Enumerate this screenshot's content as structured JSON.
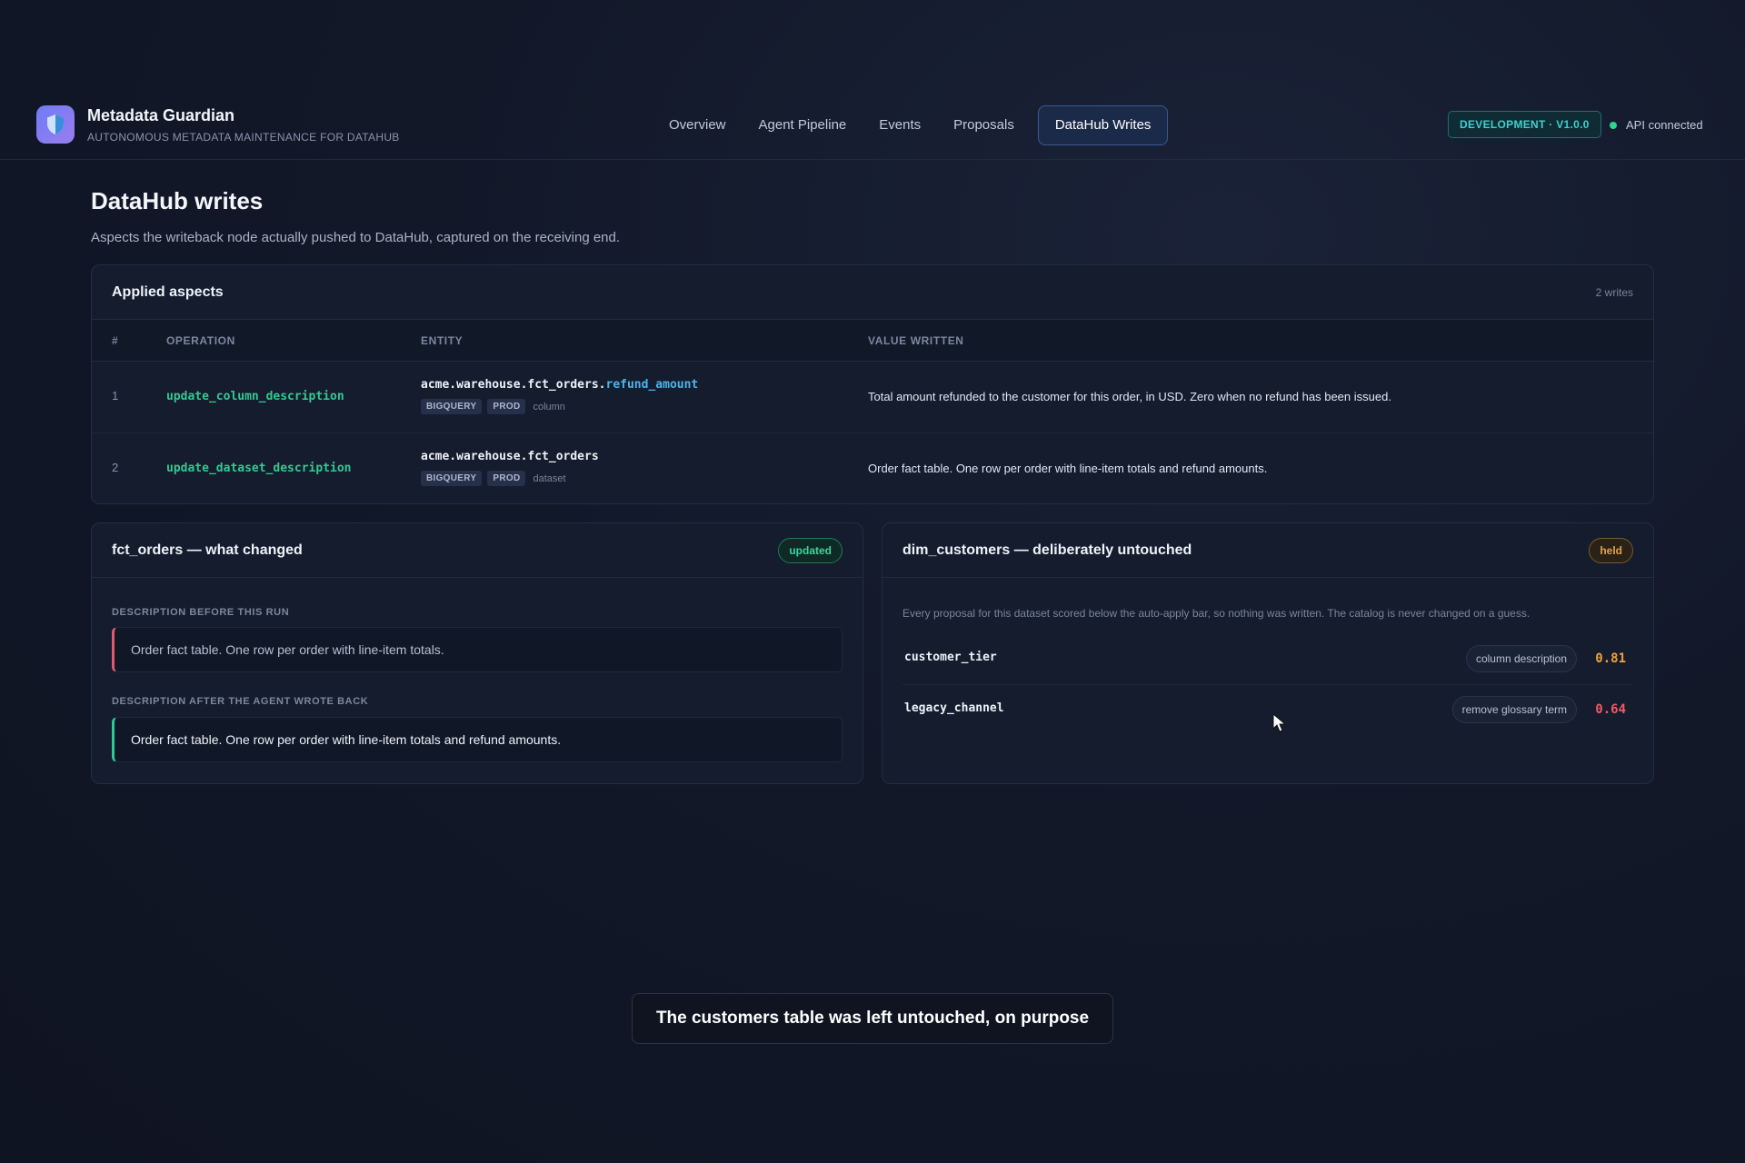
{
  "app": {
    "title": "Metadata Guardian",
    "subtitle": "AUTONOMOUS METADATA MAINTENANCE FOR DATAHUB",
    "logo_icon": "shield-icon"
  },
  "nav": {
    "items": [
      {
        "label": "Overview"
      },
      {
        "label": "Agent Pipeline"
      },
      {
        "label": "Events"
      },
      {
        "label": "Proposals"
      },
      {
        "label": "DataHub Writes",
        "active": true
      }
    ]
  },
  "status": {
    "env": "DEVELOPMENT · V1.0.0",
    "api": "API connected",
    "api_color": "#2fd48f"
  },
  "page": {
    "title": "DataHub writes",
    "subtitle": "Aspects the writeback node actually pushed to DataHub, captured on the receiving end."
  },
  "aspects": {
    "title": "Applied aspects",
    "count": "2 writes",
    "columns": {
      "num": "#",
      "operation": "OPERATION",
      "entity": "ENTITY",
      "value": "VALUE WRITTEN"
    },
    "rows": [
      {
        "num": "1",
        "operation": "update_column_description",
        "entity_base": "acme.warehouse.fct_orders.",
        "entity_column": "refund_amount",
        "platform": "BIGQUERY",
        "env": "PROD",
        "kind": "column",
        "value": "Total amount refunded to the customer for this order, in USD. Zero when no refund has been issued."
      },
      {
        "num": "2",
        "operation": "update_dataset_description",
        "entity_base": "acme.warehouse.fct_orders",
        "entity_column": "",
        "platform": "BIGQUERY",
        "env": "PROD",
        "kind": "dataset",
        "value": "Order fact table. One row per order with line-item totals and refund amounts."
      }
    ]
  },
  "changed": {
    "title": "fct_orders — what changed",
    "badge": "updated",
    "before_label": "DESCRIPTION BEFORE THIS RUN",
    "before_value": "Order fact table. One row per order with line-item totals.",
    "after_label": "DESCRIPTION AFTER THE AGENT WROTE BACK",
    "after_value": "Order fact table. One row per order with line-item totals and refund amounts."
  },
  "untouched": {
    "title": "dim_customers — deliberately untouched",
    "badge": "held",
    "note": "Every proposal for this dataset scored below the auto-apply bar, so nothing was written. The catalog is never changed on a guess.",
    "items": [
      {
        "field": "customer_tier",
        "kind": "column description",
        "score": "0.81",
        "score_color": "#f0a23c"
      },
      {
        "field": "legacy_channel",
        "kind": "remove glossary term",
        "score": "0.64",
        "score_color": "#f05a64"
      }
    ]
  },
  "caption": "The customers table was left untouched, on purpose"
}
